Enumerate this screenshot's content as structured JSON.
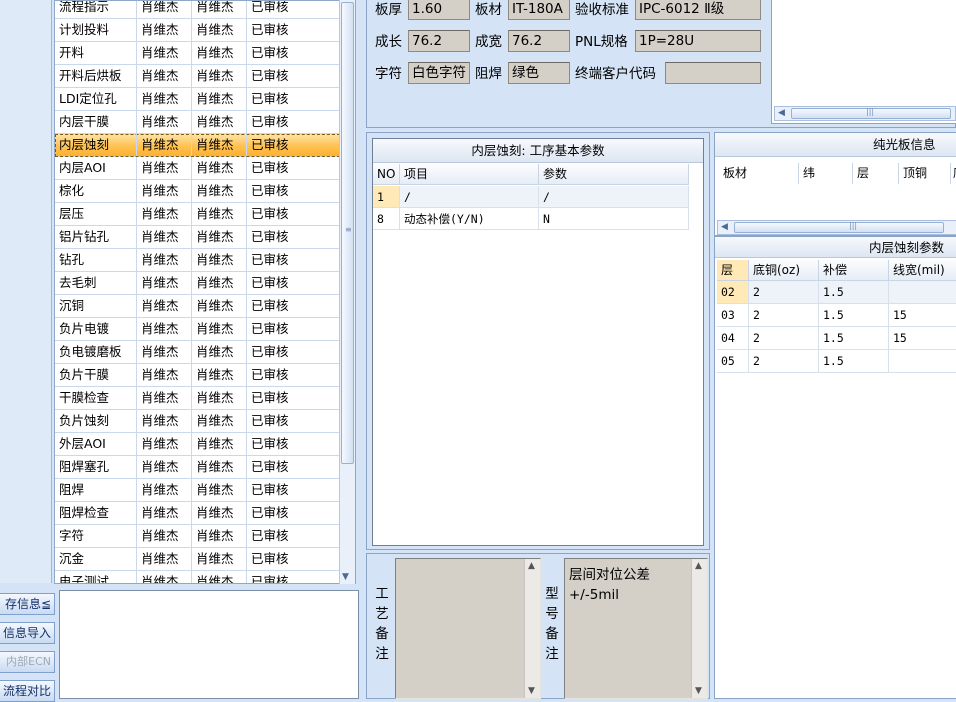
{
  "process_list": {
    "rows": [
      {
        "name": "流程指示",
        "c1": "肖维杰",
        "c2": "肖维杰",
        "c3": "已审核"
      },
      {
        "name": "计划投料",
        "c1": "肖维杰",
        "c2": "肖维杰",
        "c3": "已审核"
      },
      {
        "name": "开料",
        "c1": "肖维杰",
        "c2": "肖维杰",
        "c3": "已审核"
      },
      {
        "name": "开料后烘板",
        "c1": "肖维杰",
        "c2": "肖维杰",
        "c3": "已审核"
      },
      {
        "name": "LDI定位孔",
        "c1": "肖维杰",
        "c2": "肖维杰",
        "c3": "已审核"
      },
      {
        "name": "内层干膜",
        "c1": "肖维杰",
        "c2": "肖维杰",
        "c3": "已审核"
      },
      {
        "name": "内层蚀刻",
        "c1": "肖维杰",
        "c2": "肖维杰",
        "c3": "已审核",
        "selected": true
      },
      {
        "name": "内层AOI",
        "c1": "肖维杰",
        "c2": "肖维杰",
        "c3": "已审核"
      },
      {
        "name": "棕化",
        "c1": "肖维杰",
        "c2": "肖维杰",
        "c3": "已审核"
      },
      {
        "name": "层压",
        "c1": "肖维杰",
        "c2": "肖维杰",
        "c3": "已审核"
      },
      {
        "name": "铝片钻孔",
        "c1": "肖维杰",
        "c2": "肖维杰",
        "c3": "已审核"
      },
      {
        "name": "钻孔",
        "c1": "肖维杰",
        "c2": "肖维杰",
        "c3": "已审核"
      },
      {
        "name": "去毛刺",
        "c1": "肖维杰",
        "c2": "肖维杰",
        "c3": "已审核"
      },
      {
        "name": "沉铜",
        "c1": "肖维杰",
        "c2": "肖维杰",
        "c3": "已审核"
      },
      {
        "name": "负片电镀",
        "c1": "肖维杰",
        "c2": "肖维杰",
        "c3": "已审核"
      },
      {
        "name": "负电镀磨板",
        "c1": "肖维杰",
        "c2": "肖维杰",
        "c3": "已审核"
      },
      {
        "name": "负片干膜",
        "c1": "肖维杰",
        "c2": "肖维杰",
        "c3": "已审核"
      },
      {
        "name": "干膜检查",
        "c1": "肖维杰",
        "c2": "肖维杰",
        "c3": "已审核"
      },
      {
        "name": "负片蚀刻",
        "c1": "肖维杰",
        "c2": "肖维杰",
        "c3": "已审核"
      },
      {
        "name": "外层AOI",
        "c1": "肖维杰",
        "c2": "肖维杰",
        "c3": "已审核"
      },
      {
        "name": "阻焊塞孔",
        "c1": "肖维杰",
        "c2": "肖维杰",
        "c3": "已审核"
      },
      {
        "name": "阻焊",
        "c1": "肖维杰",
        "c2": "肖维杰",
        "c3": "已审核"
      },
      {
        "name": "阻焊检查",
        "c1": "肖维杰",
        "c2": "肖维杰",
        "c3": "已审核"
      },
      {
        "name": "字符",
        "c1": "肖维杰",
        "c2": "肖维杰",
        "c3": "已审核"
      },
      {
        "name": "沉金",
        "c1": "肖维杰",
        "c2": "肖维杰",
        "c3": "已审核"
      },
      {
        "name": "电子测试",
        "c1": "肖维杰",
        "c2": "肖维杰",
        "c3": "已审核"
      }
    ]
  },
  "side_buttons": {
    "save": "存信息≦",
    "import": "信息导入",
    "ecn": "内部ECN",
    "compare": "流程对比"
  },
  "info": {
    "thickness_label": "板厚",
    "thickness_value": "1.60",
    "material_label": "板材",
    "material_value": "IT-180A",
    "standard_label": "验收标准",
    "standard_value": "IPC-6012 Ⅱ级",
    "length_label": "成长",
    "length_value": "76.2",
    "width_label": "成宽",
    "width_value": "76.2",
    "pnl_label": "PNL规格",
    "pnl_value": "1P=28U",
    "char_label": "字符",
    "char_value": "白色字符",
    "mask_label": "阻焊",
    "mask_value": "绿色",
    "customer_code_label": "终端客户代码",
    "customer_code_value": ""
  },
  "process_params": {
    "title": "内层蚀刻: 工序基本参数",
    "headers": [
      "NO",
      "项目",
      "参数"
    ],
    "rows": [
      {
        "no": "1",
        "item": "/",
        "value": "/"
      },
      {
        "no": "8",
        "item": "动态补偿(Y/N)",
        "value": "N"
      }
    ]
  },
  "blank_board": {
    "title": "纯光板信息",
    "headers": [
      "板材",
      "纬",
      "层",
      "顶铜",
      "底"
    ]
  },
  "etch_params": {
    "title": "内层蚀刻参数",
    "headers": [
      "层",
      "底铜(oz)",
      "补偿",
      "线宽(mil)"
    ],
    "rows": [
      {
        "layer": "02",
        "base": "2",
        "comp": "1.5",
        "width": ""
      },
      {
        "layer": "03",
        "base": "2",
        "comp": "1.5",
        "width": "15"
      },
      {
        "layer": "04",
        "base": "2",
        "comp": "1.5",
        "width": "15"
      },
      {
        "layer": "05",
        "base": "2",
        "comp": "1.5",
        "width": ""
      }
    ]
  },
  "notes": {
    "process_label": "工艺备注",
    "process_text": "",
    "model_label": "型号备注",
    "model_text": "层间对位公差+/-5mil"
  },
  "colors": {
    "panel_bg": "#d4e3f5",
    "selection": "#ffc251",
    "field_bg": "#d4d0c8"
  }
}
